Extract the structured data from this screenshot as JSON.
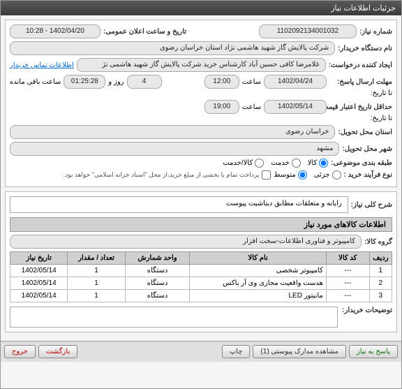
{
  "window": {
    "title": "جزئیات اطلاعات نیاز"
  },
  "fields": {
    "need_number_label": "شماره نیاز:",
    "need_number": "1102092134001032",
    "announce_label": "تاریخ و ساعت اعلان عمومی:",
    "announce_value": "1402/04/20 - 10:28",
    "buyer_org_label": "نام دستگاه خریدار:",
    "buyer_org": "شرکت پالایش گاز شهید هاشمی نژاد   استان خراسان رضوی",
    "requester_label": "ایجاد کننده درخواست:",
    "requester": "غلامرضا کافی حسین آباد کارشناس خرید  شرکت پالایش گاز شهید هاشمی نژ",
    "contact_link": "اطلاعات تماس خریدار",
    "deadline_label": "مهلت ارسال پاسخ:",
    "to_label": "تا تاریخ:",
    "deadline_date": "1402/04/24",
    "time_label": "ساعت",
    "deadline_time": "12:00",
    "day_label": "روز و",
    "days": "4",
    "countdown": "01:25:28",
    "remaining_label": "ساعت باقی مانده",
    "validity_label": "حداقل تاریخ اعتبار قیمت:",
    "validity_to_label": "تا تاریخ:",
    "validity_date": "1402/05/14",
    "validity_time": "19:00",
    "province_label": "استان محل تحویل:",
    "province": "خراسان رضوی",
    "city_label": "شهر محل تحویل:",
    "city": "مشهد",
    "category_label": "طبقه بندی موضوعی:",
    "cat_kala": "کالا",
    "cat_khadamat": "خدمت",
    "cat_both": "کالا/خدمت",
    "purchase_type_label": "نوع فرآیند خرید :",
    "pt_small": "جزئی",
    "pt_medium": "متوسط",
    "pt_note": "پرداخت تمام یا بخشی از مبلغ خرید،از محل \"اسناد خزانه اسلامی\" خواهد بود.",
    "summary_label": "شرح کلی نیاز:",
    "summary": "رایانه و متعلقات مطابق دیتاشیت پیوست",
    "items_header": "اطلاعات کالاهای مورد نیاز",
    "group_label": "گروه کالا:",
    "group": "کامپیوتر و فناوری اطلاعات-سخت افزار",
    "buyer_notes_label": "توضیحات خریدار:"
  },
  "table": {
    "headers": {
      "row": "ردیف",
      "code": "کد کالا",
      "name": "نام کالا",
      "unit": "واحد شمارش",
      "qty": "تعداد / مقدار",
      "date": "تاریخ نیاز"
    },
    "rows": [
      {
        "n": "1",
        "code": "---",
        "name": "کامپیوتر شخصی",
        "unit": "دستگاه",
        "qty": "1",
        "date": "1402/05/14"
      },
      {
        "n": "2",
        "code": "---",
        "name": "هدست واقعیت مجازی وی آر باکس",
        "unit": "دستگاه",
        "qty": "1",
        "date": "1402/05/14"
      },
      {
        "n": "3",
        "code": "---",
        "name": "مانیتور LED",
        "unit": "دستگاه",
        "qty": "1",
        "date": "1402/05/14"
      }
    ]
  },
  "buttons": {
    "respond": "پاسخ به نیاز",
    "attachments": "مشاهده مدارک پیوستی (1)",
    "print": "چاپ",
    "back": "بازگشت",
    "exit": "خروج"
  }
}
